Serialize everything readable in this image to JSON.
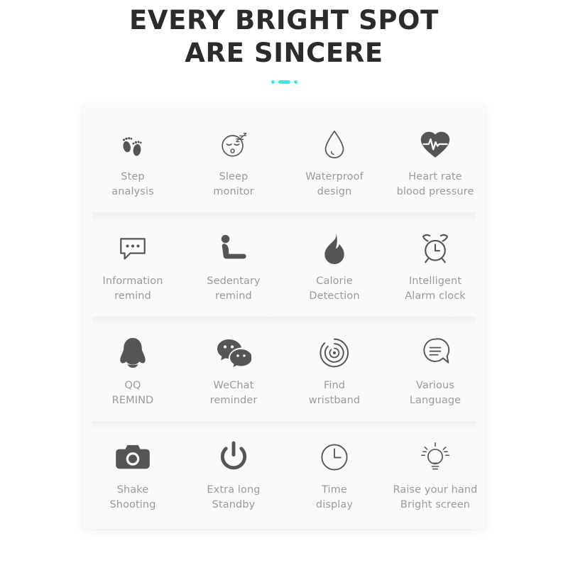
{
  "header": {
    "title_line1": "EVERY BRIGHT SPOT",
    "title_line2": "ARE SINCERE",
    "accent_color": "#3be8ee",
    "text_color": "#2b2b2b"
  },
  "card": {
    "background": "#fafafa",
    "label_color": "#9a9a9a",
    "icon_color": "#555555",
    "rows": [
      {
        "cells": [
          {
            "icon": "footprints-icon",
            "label": "Step\nanalysis"
          },
          {
            "icon": "sleeping-face-icon",
            "label": "Sleep\nmonitor"
          },
          {
            "icon": "water-droplet-icon",
            "label": "Waterproof\ndesign"
          },
          {
            "icon": "heart-pulse-icon",
            "label": "Heart rate\nblood pressure"
          }
        ]
      },
      {
        "cells": [
          {
            "icon": "speech-bubble-dots-icon",
            "label": "Information\nremind"
          },
          {
            "icon": "seated-person-icon",
            "label": "Sedentary\nremind"
          },
          {
            "icon": "flame-icon",
            "label": "Calorie\nDetection"
          },
          {
            "icon": "alarm-clock-icon",
            "label": "Intelligent\nAlarm clock"
          }
        ]
      },
      {
        "cells": [
          {
            "icon": "qq-penguin-icon",
            "label": "QQ\nREMIND"
          },
          {
            "icon": "wechat-bubbles-icon",
            "label": "WeChat\nreminder"
          },
          {
            "icon": "concentric-rings-icon",
            "label": "Find\nwristband"
          },
          {
            "icon": "speech-bubble-lines-icon",
            "label": "Various\nLanguage"
          }
        ]
      },
      {
        "cells": [
          {
            "icon": "camera-icon",
            "label": "Shake\nShooting"
          },
          {
            "icon": "power-icon",
            "label": "Extra long\nStandby"
          },
          {
            "icon": "clock-icon",
            "label": "Time\ndisplay"
          },
          {
            "icon": "light-bulb-icon",
            "label": "Raise your hand\nBright screen"
          }
        ]
      }
    ]
  }
}
